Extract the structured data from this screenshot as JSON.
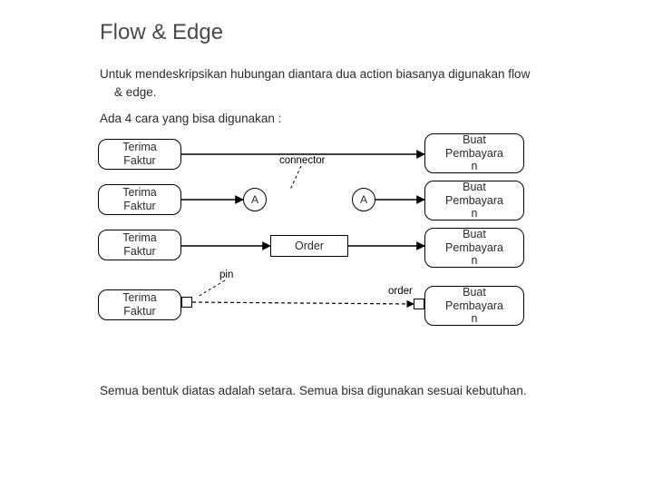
{
  "title": "Flow & Edge",
  "intro_line1": "Untuk mendeskripsikan hubungan diantara dua action biasanya digunakan flow",
  "intro_line2": "& edge.",
  "intro2": "Ada 4 cara yang bisa digunakan :",
  "labels": {
    "connector": "connector",
    "pin": "pin",
    "order_param": "order"
  },
  "nodes": {
    "leftA": "Terima\nFaktur",
    "leftB": "Terima\nFaktur",
    "leftC": "Terima\nFaktur",
    "leftD": "Terima\nFaktur",
    "rightA": "Buat\nPembayara\nn",
    "rightB": "Buat\nPembayara\nn",
    "rightC": "Buat\nPembayara\nn",
    "rightD": "Buat\nPembayara\nn",
    "circ1": "A",
    "circ2": "A",
    "objBox": "Order"
  },
  "footer": "Semua bentuk diatas  adalah setara. Semua bisa digunakan sesuai kebutuhan."
}
